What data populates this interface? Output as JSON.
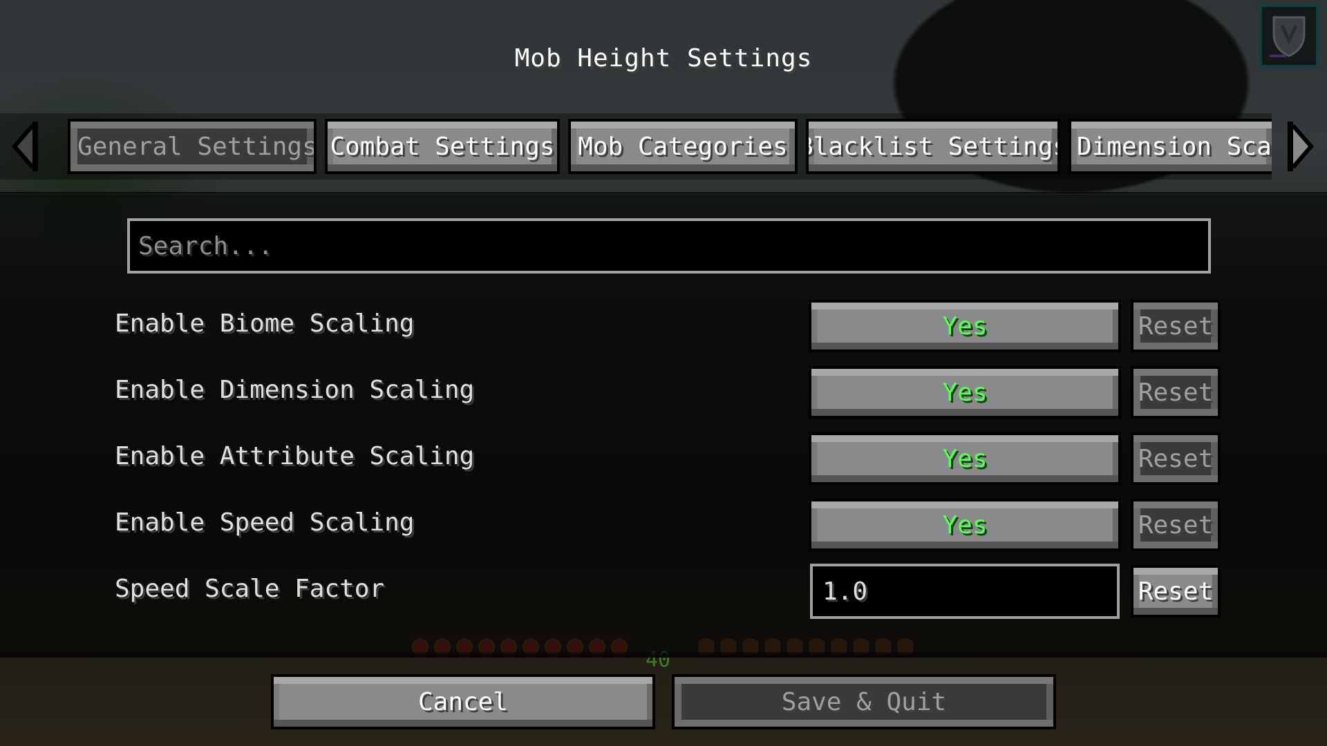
{
  "screen": {
    "title": "Mob Height Settings"
  },
  "tabs": {
    "scroll_left_icon": "arrow-left-icon",
    "scroll_right_icon": "arrow-right-icon",
    "items": [
      {
        "label": "General Settings",
        "active": true
      },
      {
        "label": "Combat Settings",
        "active": false
      },
      {
        "label": "Mob Categories",
        "active": false
      },
      {
        "label": "Blacklist Settings",
        "active": false
      },
      {
        "label": "Dimension Scal",
        "active": false
      }
    ]
  },
  "search": {
    "placeholder": "Search...",
    "value": ""
  },
  "settings": [
    {
      "label": "Enable Biome Scaling",
      "type": "toggle",
      "value": "Yes",
      "reset_label": "Reset",
      "reset_enabled": false
    },
    {
      "label": "Enable Dimension Scaling",
      "type": "toggle",
      "value": "Yes",
      "reset_label": "Reset",
      "reset_enabled": false
    },
    {
      "label": "Enable Attribute Scaling",
      "type": "toggle",
      "value": "Yes",
      "reset_label": "Reset",
      "reset_enabled": false
    },
    {
      "label": "Enable Speed Scaling",
      "type": "toggle",
      "value": "Yes",
      "reset_label": "Reset",
      "reset_enabled": false
    },
    {
      "label": "Speed Scale Factor",
      "type": "text",
      "value": "1.0",
      "reset_label": "Reset",
      "reset_enabled": true
    }
  ],
  "footer": {
    "cancel_label": "Cancel",
    "save_label": "Save & Quit",
    "save_enabled": false
  },
  "hud": {
    "xp_level": "40",
    "hearts": 10,
    "food": 10
  },
  "colors": {
    "toggle_on": "#55ff55",
    "text_primary": "#ffffff",
    "text_disabled": "#a0a0a0",
    "corner_icon_border": "#0f3f3f"
  }
}
